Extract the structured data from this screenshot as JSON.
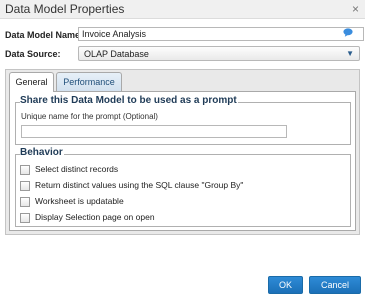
{
  "dialog": {
    "title": "Data Model Properties",
    "close_glyph": "×"
  },
  "form": {
    "name_label": "Data Model Name:",
    "name_value": "Invoice Analysis",
    "source_label": "Data Source:",
    "source_value": "OLAP Database"
  },
  "tabs": [
    {
      "label": "General",
      "active": true
    },
    {
      "label": "Performance",
      "active": false
    }
  ],
  "prompt_group": {
    "legend": "Share this Data Model to be used as a prompt",
    "hint": "Unique name for the prompt (Optional)",
    "value": ""
  },
  "behavior": {
    "legend": "Behavior",
    "options": [
      {
        "label": "Select distinct records",
        "checked": false
      },
      {
        "label": "Return distinct values using the SQL clause \"Group By\"",
        "checked": false
      },
      {
        "label": "Worksheet is updatable",
        "checked": false
      },
      {
        "label": "Display Selection page on open",
        "checked": false
      }
    ]
  },
  "buttons": {
    "ok": "OK",
    "cancel": "Cancel"
  },
  "colors": {
    "accent": "#1b70b8",
    "legend_text": "#1f3b57",
    "icon_blue": "#3a8dde"
  },
  "icons": {
    "name_field": "chat-bubble-icon",
    "source_dropdown": "chevron-down-icon",
    "close": "close-icon"
  }
}
